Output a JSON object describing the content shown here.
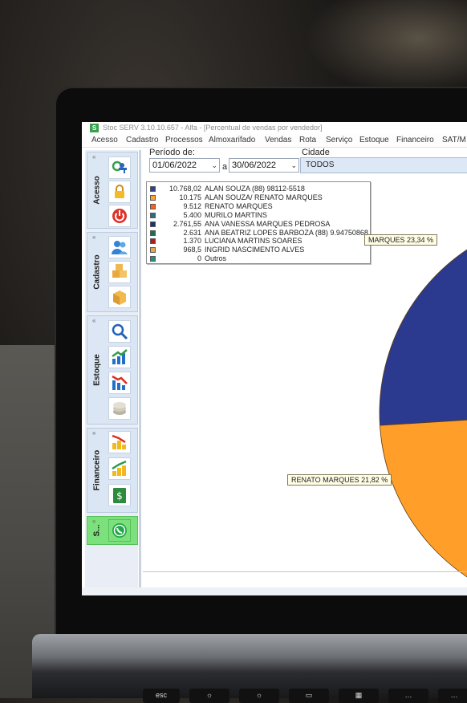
{
  "window": {
    "title": "Stoc SERV 3.10.10.657 - Alfa - [Percentual de vendas por vendedor]",
    "app_icon_letter": "S"
  },
  "menu": [
    "Acesso",
    "Cadastro",
    "Processos",
    "Almoxarifado",
    "Vendas",
    "Rota",
    "Serviço",
    "Estoque",
    "Financeiro",
    "SAT/M"
  ],
  "sidebar": {
    "groups": [
      {
        "label": "Acesso",
        "icons": [
          "refresh-key-icon",
          "lock-icon",
          "power-icon"
        ]
      },
      {
        "label": "Cadastro",
        "icons": [
          "users-icon",
          "boxes-icon",
          "box-icon"
        ]
      },
      {
        "label": "Estoque",
        "icons": [
          "magnifier-icon",
          "bar-chart-up-icon",
          "bar-chart-down-icon",
          "coins-icon"
        ]
      },
      {
        "label": "Financeiro",
        "icons": [
          "chart-down-red-icon",
          "chart-up-green-icon",
          "money-document-icon"
        ]
      },
      {
        "label": "S...",
        "icons": [
          "whatsapp-icon"
        ]
      }
    ]
  },
  "filters": {
    "periodo_label": "Período de:",
    "date_from": "01/06/2022",
    "separator": "a",
    "date_to": "30/06/2022",
    "cidade_label": "Cidade",
    "cidade_value": "TODOS"
  },
  "chart_data": {
    "type": "pie",
    "series": [
      {
        "name": "ALAN SOUZA (88) 98112-5518",
        "value": 10768.02,
        "value_label": "10.768,02",
        "color": "#2b3a8f"
      },
      {
        "name": "ALAN SOUZA/ RENATO MARQUES",
        "value": 10175,
        "value_label": "10.175",
        "color": "#ff9f2a"
      },
      {
        "name": "RENATO MARQUES",
        "value": 9512,
        "value_label": "9.512",
        "color": "#ff5a12"
      },
      {
        "name": "MURILO MARTINS",
        "value": 5400,
        "value_label": "5.400",
        "color": "#1e6d7c"
      },
      {
        "name": "ANA VANESSA MARQUES PEDROSA",
        "value": 2761.55,
        "value_label": "2.761,55",
        "color": "#1c2a6e"
      },
      {
        "name": "ANA BEATRIZ LOPES BARBOZA (88) 9.94750868",
        "value": 2631,
        "value_label": "2.631",
        "color": "#156b52"
      },
      {
        "name": "LUCIANA MARTINS SOARES",
        "value": 1370,
        "value_label": "1.370",
        "color": "#b01616"
      },
      {
        "name": "INGRID NASCIMENTO ALVES",
        "value": 968.5,
        "value_label": "968,5",
        "color": "#e8a24a"
      },
      {
        "name": "Outros",
        "value": 0,
        "value_label": "0",
        "color": "#1f8f77"
      }
    ],
    "slice_labels": [
      {
        "text": "MARQUES 23,34 %",
        "series": "ALAN SOUZA/ RENATO MARQUES"
      },
      {
        "text": "RENATO MARQUES 21,82 %",
        "series": "RENATO MARQUES"
      }
    ]
  }
}
